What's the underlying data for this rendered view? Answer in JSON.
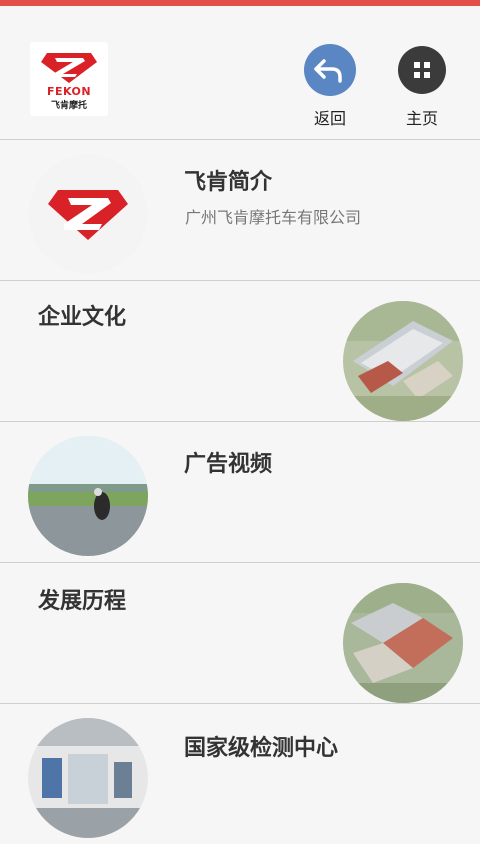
{
  "header": {
    "logo_brand": "FEKON",
    "logo_cn": "飞肯摩托",
    "back_label": "返回",
    "home_label": "主页",
    "accent_color": "#e2504c",
    "back_color": "#5a86c3",
    "home_color": "#3b3b3b"
  },
  "items": [
    {
      "title": "飞肯简介",
      "subtitle": "广州飞肯摩托车有限公司",
      "icon": "fekon-z-logo-icon"
    },
    {
      "title": "企业文化",
      "icon": "factory-aerial-photo"
    },
    {
      "title": "广告视频",
      "icon": "motorcycle-racing-photo"
    },
    {
      "title": "发展历程",
      "icon": "factory-campus-photo"
    },
    {
      "title": "国家级检测中心",
      "icon": "testing-lab-photo"
    }
  ]
}
